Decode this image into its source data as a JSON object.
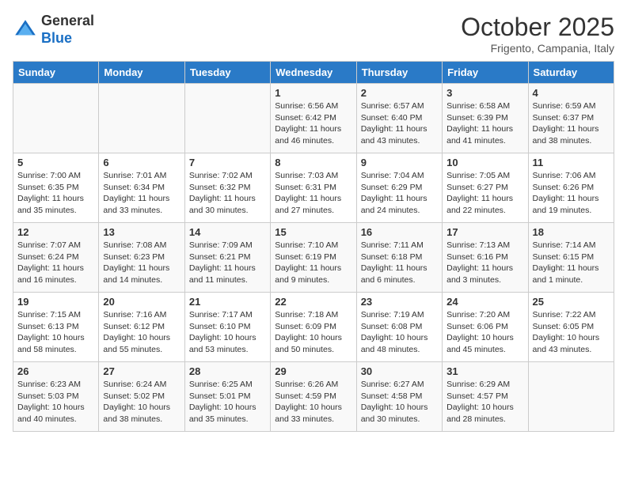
{
  "header": {
    "logo_general": "General",
    "logo_blue": "Blue",
    "month": "October 2025",
    "location": "Frigento, Campania, Italy"
  },
  "days_of_week": [
    "Sunday",
    "Monday",
    "Tuesday",
    "Wednesday",
    "Thursday",
    "Friday",
    "Saturday"
  ],
  "weeks": [
    [
      {
        "day": "",
        "info": ""
      },
      {
        "day": "",
        "info": ""
      },
      {
        "day": "",
        "info": ""
      },
      {
        "day": "1",
        "info": "Sunrise: 6:56 AM\nSunset: 6:42 PM\nDaylight: 11 hours\nand 46 minutes."
      },
      {
        "day": "2",
        "info": "Sunrise: 6:57 AM\nSunset: 6:40 PM\nDaylight: 11 hours\nand 43 minutes."
      },
      {
        "day": "3",
        "info": "Sunrise: 6:58 AM\nSunset: 6:39 PM\nDaylight: 11 hours\nand 41 minutes."
      },
      {
        "day": "4",
        "info": "Sunrise: 6:59 AM\nSunset: 6:37 PM\nDaylight: 11 hours\nand 38 minutes."
      }
    ],
    [
      {
        "day": "5",
        "info": "Sunrise: 7:00 AM\nSunset: 6:35 PM\nDaylight: 11 hours\nand 35 minutes."
      },
      {
        "day": "6",
        "info": "Sunrise: 7:01 AM\nSunset: 6:34 PM\nDaylight: 11 hours\nand 33 minutes."
      },
      {
        "day": "7",
        "info": "Sunrise: 7:02 AM\nSunset: 6:32 PM\nDaylight: 11 hours\nand 30 minutes."
      },
      {
        "day": "8",
        "info": "Sunrise: 7:03 AM\nSunset: 6:31 PM\nDaylight: 11 hours\nand 27 minutes."
      },
      {
        "day": "9",
        "info": "Sunrise: 7:04 AM\nSunset: 6:29 PM\nDaylight: 11 hours\nand 24 minutes."
      },
      {
        "day": "10",
        "info": "Sunrise: 7:05 AM\nSunset: 6:27 PM\nDaylight: 11 hours\nand 22 minutes."
      },
      {
        "day": "11",
        "info": "Sunrise: 7:06 AM\nSunset: 6:26 PM\nDaylight: 11 hours\nand 19 minutes."
      }
    ],
    [
      {
        "day": "12",
        "info": "Sunrise: 7:07 AM\nSunset: 6:24 PM\nDaylight: 11 hours\nand 16 minutes."
      },
      {
        "day": "13",
        "info": "Sunrise: 7:08 AM\nSunset: 6:23 PM\nDaylight: 11 hours\nand 14 minutes."
      },
      {
        "day": "14",
        "info": "Sunrise: 7:09 AM\nSunset: 6:21 PM\nDaylight: 11 hours\nand 11 minutes."
      },
      {
        "day": "15",
        "info": "Sunrise: 7:10 AM\nSunset: 6:19 PM\nDaylight: 11 hours\nand 9 minutes."
      },
      {
        "day": "16",
        "info": "Sunrise: 7:11 AM\nSunset: 6:18 PM\nDaylight: 11 hours\nand 6 minutes."
      },
      {
        "day": "17",
        "info": "Sunrise: 7:13 AM\nSunset: 6:16 PM\nDaylight: 11 hours\nand 3 minutes."
      },
      {
        "day": "18",
        "info": "Sunrise: 7:14 AM\nSunset: 6:15 PM\nDaylight: 11 hours\nand 1 minute."
      }
    ],
    [
      {
        "day": "19",
        "info": "Sunrise: 7:15 AM\nSunset: 6:13 PM\nDaylight: 10 hours\nand 58 minutes."
      },
      {
        "day": "20",
        "info": "Sunrise: 7:16 AM\nSunset: 6:12 PM\nDaylight: 10 hours\nand 55 minutes."
      },
      {
        "day": "21",
        "info": "Sunrise: 7:17 AM\nSunset: 6:10 PM\nDaylight: 10 hours\nand 53 minutes."
      },
      {
        "day": "22",
        "info": "Sunrise: 7:18 AM\nSunset: 6:09 PM\nDaylight: 10 hours\nand 50 minutes."
      },
      {
        "day": "23",
        "info": "Sunrise: 7:19 AM\nSunset: 6:08 PM\nDaylight: 10 hours\nand 48 minutes."
      },
      {
        "day": "24",
        "info": "Sunrise: 7:20 AM\nSunset: 6:06 PM\nDaylight: 10 hours\nand 45 minutes."
      },
      {
        "day": "25",
        "info": "Sunrise: 7:22 AM\nSunset: 6:05 PM\nDaylight: 10 hours\nand 43 minutes."
      }
    ],
    [
      {
        "day": "26",
        "info": "Sunrise: 6:23 AM\nSunset: 5:03 PM\nDaylight: 10 hours\nand 40 minutes."
      },
      {
        "day": "27",
        "info": "Sunrise: 6:24 AM\nSunset: 5:02 PM\nDaylight: 10 hours\nand 38 minutes."
      },
      {
        "day": "28",
        "info": "Sunrise: 6:25 AM\nSunset: 5:01 PM\nDaylight: 10 hours\nand 35 minutes."
      },
      {
        "day": "29",
        "info": "Sunrise: 6:26 AM\nSunset: 4:59 PM\nDaylight: 10 hours\nand 33 minutes."
      },
      {
        "day": "30",
        "info": "Sunrise: 6:27 AM\nSunset: 4:58 PM\nDaylight: 10 hours\nand 30 minutes."
      },
      {
        "day": "31",
        "info": "Sunrise: 6:29 AM\nSunset: 4:57 PM\nDaylight: 10 hours\nand 28 minutes."
      },
      {
        "day": "",
        "info": ""
      }
    ]
  ]
}
